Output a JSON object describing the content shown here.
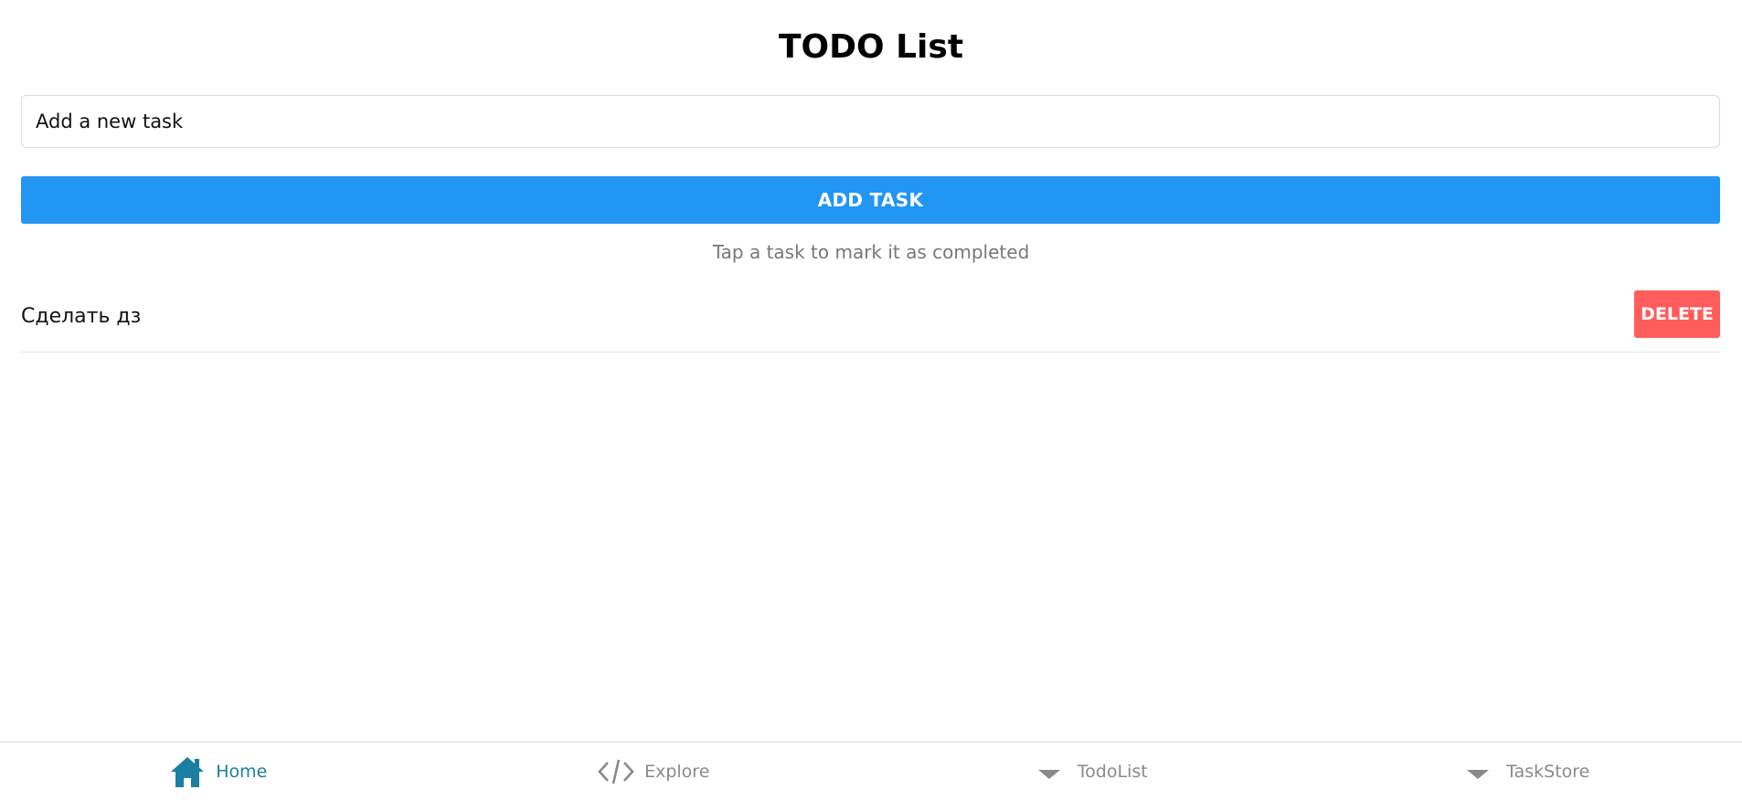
{
  "header": {
    "title": "TODO List"
  },
  "form": {
    "input_placeholder": "Add a new task",
    "add_label": "ADD TASK"
  },
  "hint": "Tap a task to mark it as completed",
  "tasks": [
    {
      "text": "Сделать дз",
      "delete_label": "DELETE"
    }
  ],
  "nav": {
    "items": [
      {
        "label": "Home",
        "icon": "home-icon",
        "active": true
      },
      {
        "label": "Explore",
        "icon": "code-icon",
        "active": false
      },
      {
        "label": "TodoList",
        "icon": "caret-down-icon",
        "active": false
      },
      {
        "label": "TaskStore",
        "icon": "caret-down-icon",
        "active": false
      }
    ]
  },
  "colors": {
    "primary": "#2196f3",
    "danger": "#ff5c5c",
    "nav_active": "#1a7fa0",
    "nav_inactive": "#8a8a8a"
  }
}
